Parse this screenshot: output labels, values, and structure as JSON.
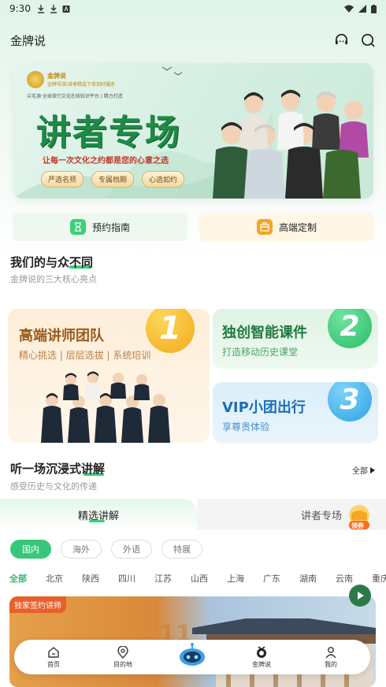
{
  "status_bar": {
    "time": "9:30"
  },
  "app_bar": {
    "title": "金牌说"
  },
  "banner": {
    "brand": "金牌说",
    "brand_sub": "金牌导游/讲者精选下单到好服务",
    "tagline": "兰毛源·全球旅行文化在线知识平台 | 精力打造",
    "headline": "讲者专场",
    "slogan": "让每一次文化之约都是您的心意之选",
    "pills": [
      "严选名师",
      "专属档期",
      "心选如约"
    ]
  },
  "quick_entries": [
    {
      "label": "预约指南",
      "icon": "hourglass-icon"
    },
    {
      "label": "高端定制",
      "icon": "briefcase-icon"
    }
  ],
  "section_diff": {
    "title": "我们的与众不同",
    "subtitle": "金牌说的三大核心亮点"
  },
  "highlights": [
    {
      "number": "1",
      "title": "高端讲师团队",
      "subtitle": "精心挑选 | 层层选拔 | 系统培训",
      "accent": "#f3b72a"
    },
    {
      "number": "2",
      "title": "独创智能课件",
      "subtitle": "打造移动历史课堂",
      "accent": "#3ccf7a"
    },
    {
      "number": "3",
      "title": "VIP小团出行",
      "subtitle": "享尊贵体验",
      "accent": "#3fb2ec"
    }
  ],
  "section_listen": {
    "title": "听一场沉浸式讲解",
    "subtitle": "感受历史与文化的传递",
    "more": "全部"
  },
  "tabs": {
    "active": "精选讲解",
    "inactive": "讲者专场",
    "reward": "领券"
  },
  "chips": [
    "国内",
    "海外",
    "外语",
    "特展"
  ],
  "regions": [
    "全部",
    "北京",
    "陕西",
    "四川",
    "江苏",
    "山西",
    "上海",
    "广东",
    "湖南",
    "云南",
    "重庆"
  ],
  "content_card": {
    "tag": "独家签约讲师"
  },
  "bottom_nav": [
    {
      "label": "首页",
      "icon": "home-icon"
    },
    {
      "label": "目的地",
      "icon": "location-pin-icon"
    },
    {
      "label": "",
      "icon": "robot-icon"
    },
    {
      "label": "金牌说",
      "icon": "medal-icon"
    },
    {
      "label": "我的",
      "icon": "user-icon"
    }
  ],
  "colors": {
    "brand_green": "#37c77a",
    "accent_orange": "#e8602a"
  }
}
